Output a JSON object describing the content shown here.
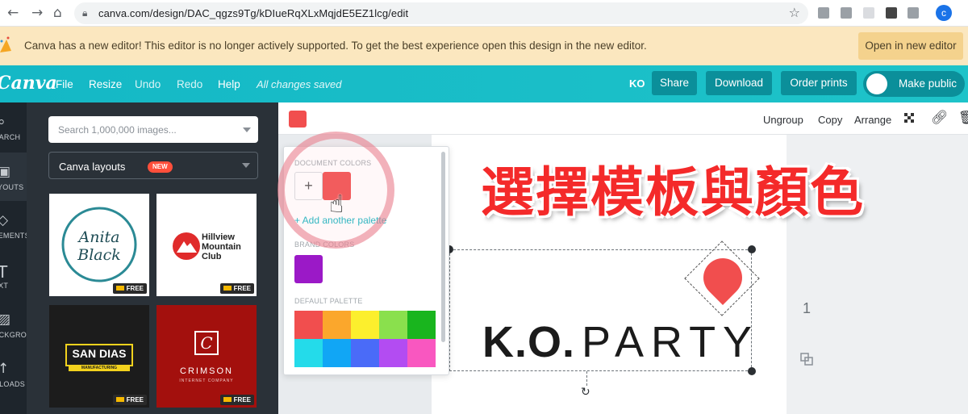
{
  "browser": {
    "url": "canva.com/design/DAC_qgzs9Tg/kDIueRqXLxMqjdE5EZ1lcg/edit",
    "profile_letter": "c",
    "icons": [
      "back-icon",
      "forward-icon",
      "home-icon",
      "lock-icon",
      "star-icon",
      "camera-icon",
      "extension-icon",
      "pocket-icon"
    ]
  },
  "notice": {
    "text": "Canva has a new editor! This editor is no longer actively supported. To get the best experience open this design in the new editor.",
    "button": "Open in new editor"
  },
  "toolbar": {
    "logo": "Canva",
    "menu": [
      "File",
      "Resize",
      "Undo",
      "Redo",
      "Help"
    ],
    "saved_status": "All changes saved",
    "user_initials": "KO",
    "share": "Share",
    "download": "Download",
    "order_prints": "Order prints",
    "make_public": "Make public"
  },
  "rail": {
    "items": [
      {
        "label": "SEARCH",
        "icon": "search-icon"
      },
      {
        "label": "LAYOUTS",
        "icon": "layouts-icon"
      },
      {
        "label": "ELEMENTS",
        "icon": "elements-icon"
      },
      {
        "label": "TEXT",
        "icon": "text-icon"
      },
      {
        "label": "BACKGROUND",
        "icon": "background-icon"
      },
      {
        "label": "UPLOADS",
        "icon": "uploads-icon"
      }
    ]
  },
  "panel": {
    "search_placeholder": "Search 1,000,000 images...",
    "layouts_label": "Canva layouts",
    "new_badge": "NEW",
    "thumbnails": [
      {
        "title_line1": "Anita",
        "title_line2": "Black",
        "badge": "FREE"
      },
      {
        "title_line1": "Hillview",
        "title_line2": "Mountain",
        "title_line3": "Club",
        "badge": "FREE"
      },
      {
        "title_line1": "SAN DIAS",
        "title_line2": "MANUFACTURING",
        "badge": "FREE"
      },
      {
        "title_line1": "C",
        "title_line2": "CRIMSON",
        "title_line3": "INTERNET COMPANY",
        "badge": "FREE"
      }
    ]
  },
  "context_bar": {
    "ungroup": "Ungroup",
    "copy": "Copy",
    "arrange": "Arrange",
    "swatch_color": "#f14e4e"
  },
  "color_picker": {
    "document_colors_label": "DOCUMENT COLORS",
    "add_color": "+",
    "document_colors": [
      "#f14e4e"
    ],
    "add_palette": "+ Add another palette",
    "brand_colors_label": "BRAND COLORS",
    "brand_colors": [
      "#9b19c7"
    ],
    "default_palette_label": "DEFAULT PALETTE",
    "default_palette": [
      "#f14e4e",
      "#fba72c",
      "#fcef2d",
      "#8ae04d",
      "#19b51e",
      "#24dbea",
      "#11a6f5",
      "#4a6bf8",
      "#b34cf2",
      "#f957c0"
    ]
  },
  "overlay_title": "選擇模板與顏色",
  "design": {
    "logo_bold": "K.O.",
    "logo_light": "PARTY",
    "page_number": "1"
  }
}
